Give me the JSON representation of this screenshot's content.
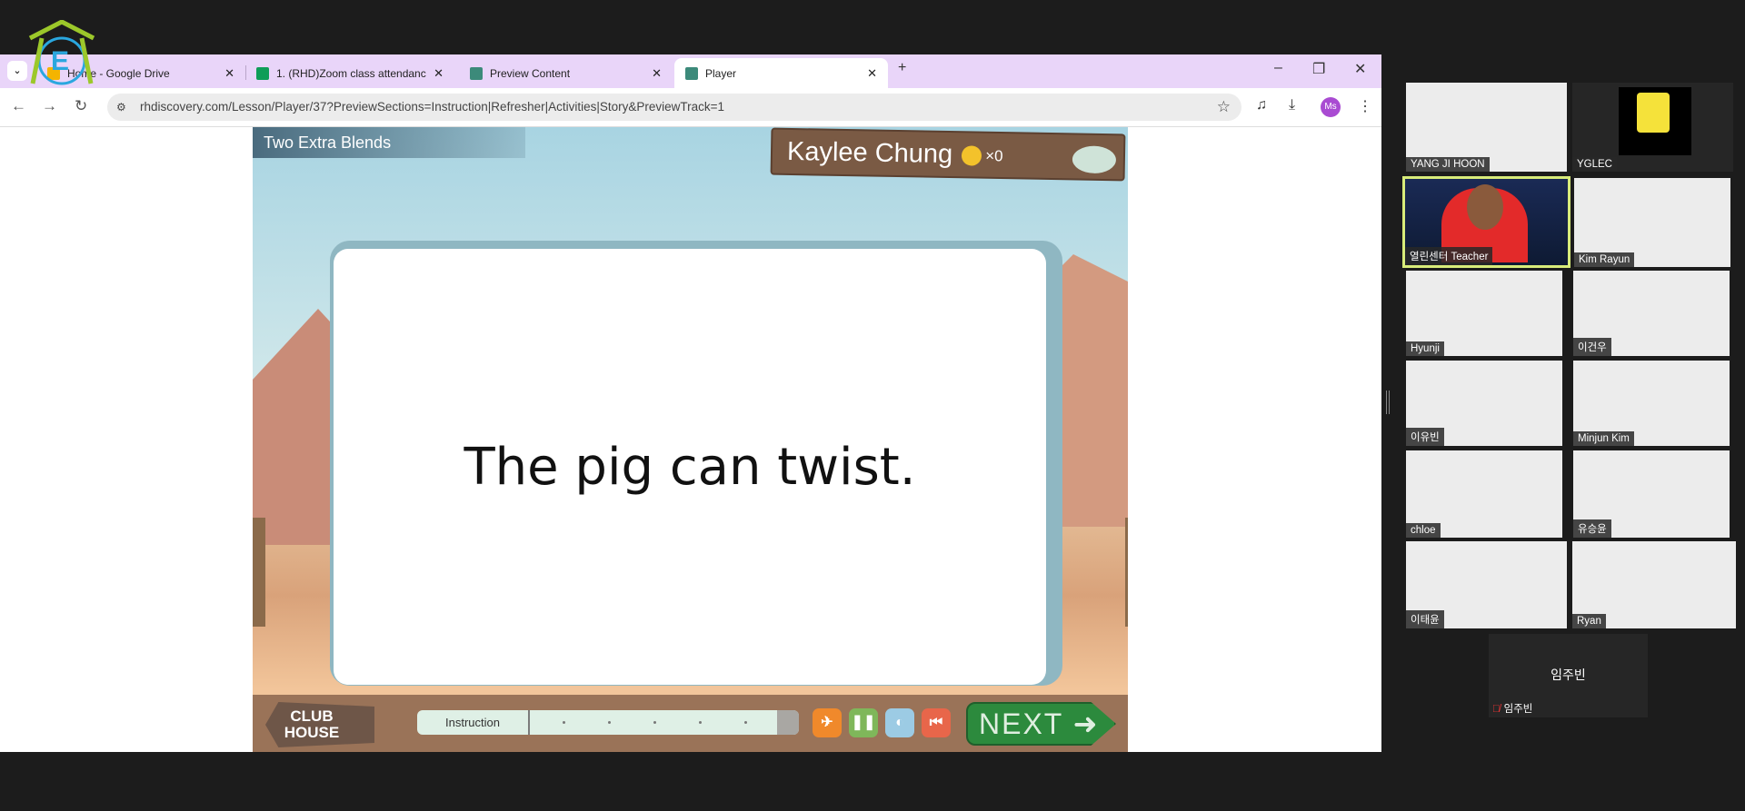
{
  "browser": {
    "tabs": [
      {
        "title": "Home - Google Drive",
        "favicon": "google-drive-icon",
        "active": false
      },
      {
        "title": "1. (RHD)Zoom class attendanc",
        "favicon": "google-sheets-icon",
        "active": false
      },
      {
        "title": "Preview Content",
        "favicon": "butterfly-icon",
        "active": false
      },
      {
        "title": "Player",
        "favicon": "butterfly-icon",
        "active": true
      }
    ],
    "new_tab": "+",
    "url": "rhdiscovery.com/Lesson/Player/37?PreviewSections=Instruction|Refresher|Activities|Story&PreviewTrack=1",
    "profile_initials": "Ms"
  },
  "lesson": {
    "title": "Two Extra Blends",
    "student_name": "Kaylee Chung",
    "coin_count": "×0",
    "sentence": "The pig can twist.",
    "club_house": "CLUB HOUSE",
    "section": "Instruction",
    "progress_steps": 5,
    "next_label": "NEXT"
  },
  "zoom": {
    "participants": [
      "YANG JI HOON",
      "YGLEC",
      "열린센터 Teacher",
      "Kim Rayun",
      "Hyunji",
      "이건우",
      "이유빈",
      "Minjun Kim",
      "chloe",
      "유승윤",
      "이태윤",
      "Ryan"
    ],
    "active_speaker": "열린센터 Teacher",
    "no_video_participant": {
      "display": "임주빈",
      "label": "임주빈",
      "muted": true
    },
    "highlight_color": "#d8ec7a"
  }
}
